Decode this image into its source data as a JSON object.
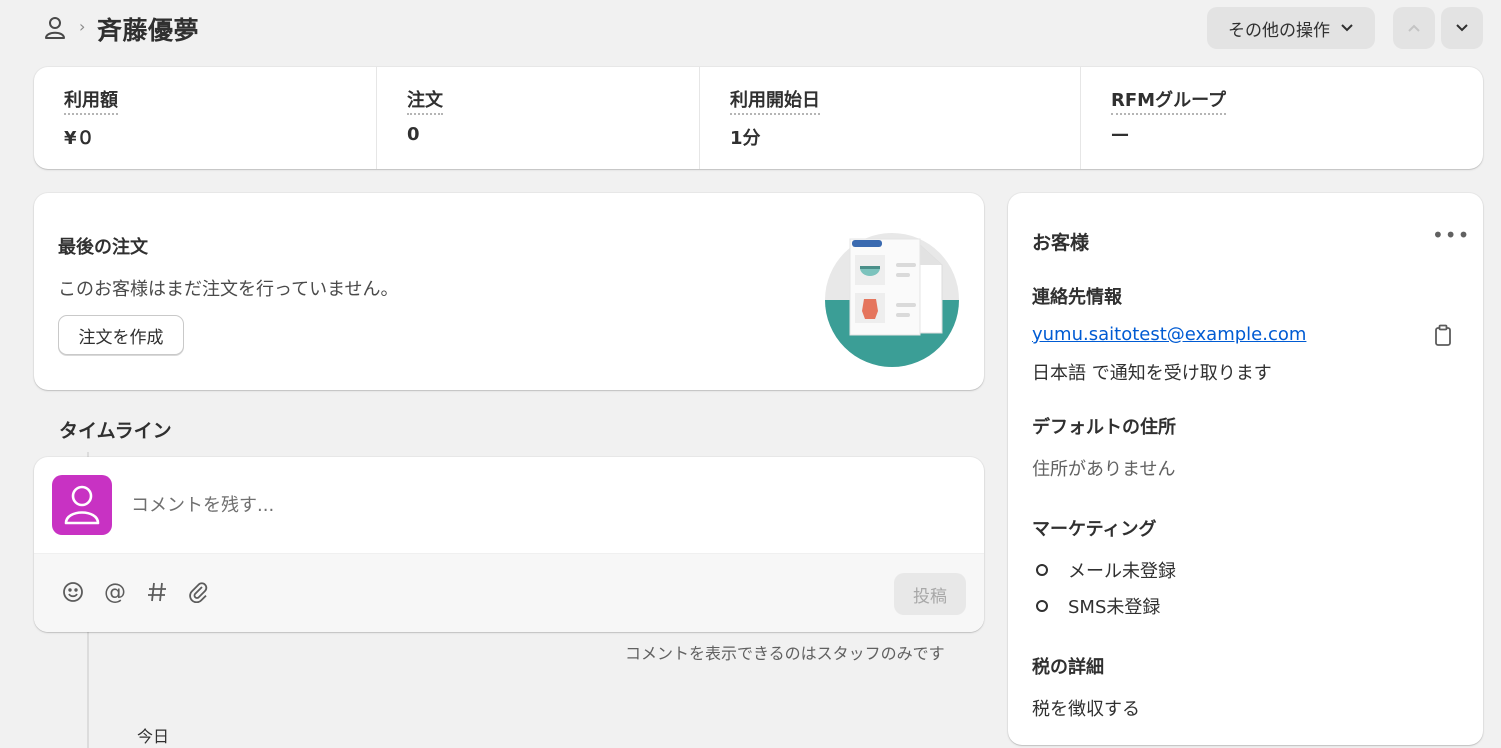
{
  "header": {
    "title": "斉藤優夢",
    "more_actions_label": "その他の操作"
  },
  "stats": [
    {
      "label": "利用額",
      "value": "¥０"
    },
    {
      "label": "注文",
      "value": "0"
    },
    {
      "label": "利用開始日",
      "value": "1分"
    },
    {
      "label": "RFMグループ",
      "value": "—"
    }
  ],
  "last_order": {
    "title": "最後の注文",
    "text": "このお客様はまだ注文を行っていません。",
    "create_button": "注文を作成"
  },
  "timeline": {
    "title": "タイムライン",
    "comment_placeholder": "コメントを残す...",
    "post_button": "投稿",
    "staff_note": "コメントを表示できるのはスタッフのみです",
    "today_label": "今日",
    "toolbar_icons": [
      "emoji-icon",
      "mention-icon",
      "hashtag-icon",
      "attachment-icon"
    ]
  },
  "customer": {
    "title": "お客様",
    "contact_heading": "連絡先情報",
    "email": "yumu.saitotest@example.com",
    "notification_text": "日本語 で通知を受け取ります",
    "address_heading": "デフォルトの住所",
    "address_text": "住所がありません",
    "marketing_heading": "マーケティング",
    "marketing_items": [
      "メール未登録",
      "SMS未登録"
    ],
    "tax_heading": "税の詳細",
    "tax_text": "税を徴収する"
  },
  "colors": {
    "background": "#f1f1f1",
    "card": "#ffffff",
    "avatar": "#c832c3",
    "link": "#005bd3",
    "illustration_teal": "#3b9e96"
  }
}
